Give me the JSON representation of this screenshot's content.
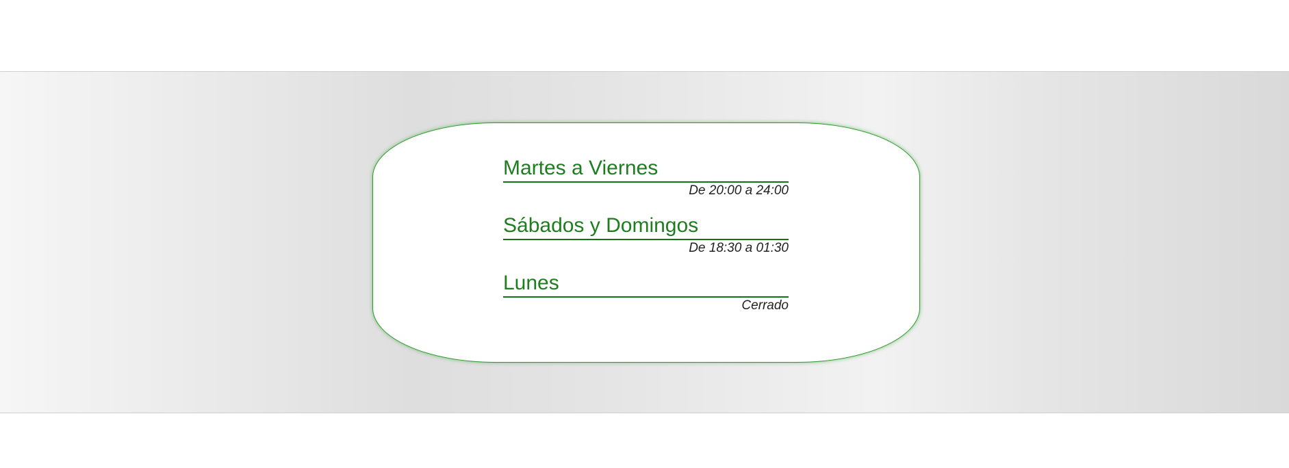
{
  "schedule": [
    {
      "day": "Martes a Viernes",
      "hours": "De 20:00 a 24:00"
    },
    {
      "day": "Sábados y Domingos",
      "hours": "De 18:30 a 01:30"
    },
    {
      "day": "Lunes",
      "hours": "Cerrado"
    }
  ],
  "colors": {
    "accent": "#1e7d1e",
    "text": "#222222",
    "card_border": "#2e9b2e"
  }
}
